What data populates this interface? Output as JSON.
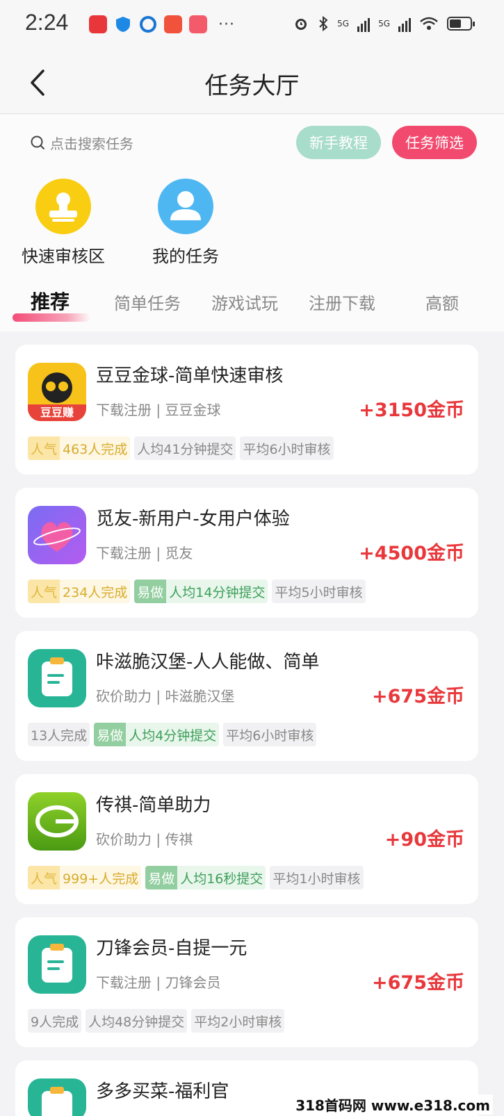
{
  "status_bar": {
    "time": "2:24",
    "more": "···",
    "net1": "5G",
    "net2": "5G"
  },
  "header": {
    "title": "任务大厅"
  },
  "search": {
    "placeholder": "点击搜索任务"
  },
  "buttons": {
    "tutorial": "新手教程",
    "filter": "任务筛选"
  },
  "quick_entries": [
    {
      "label": "快速审核区",
      "icon": "stamp-icon"
    },
    {
      "label": "我的任务",
      "icon": "user-icon"
    }
  ],
  "tabs": [
    {
      "label": "推荐",
      "active": true
    },
    {
      "label": "简单任务",
      "active": false
    },
    {
      "label": "游戏试玩",
      "active": false
    },
    {
      "label": "注册下载",
      "active": false
    },
    {
      "label": "高额",
      "active": false
    }
  ],
  "tasks": [
    {
      "title": "豆豆金球-简单快速审核",
      "subtitle": "下载注册 | 豆豆金球",
      "reward": "+3150金币",
      "icon": "doudou-app-icon",
      "icon_text": "豆豆赚",
      "tags": [
        {
          "head": "人气",
          "body": "463人完成",
          "kind": "pop"
        },
        {
          "head": "",
          "body": "人均41分钟提交",
          "kind": "grey"
        },
        {
          "head": "",
          "body": "平均6小时审核",
          "kind": "grey"
        }
      ]
    },
    {
      "title": "觅友-新用户-女用户体验",
      "subtitle": "下载注册 | 觅友",
      "reward": "+4500金币",
      "icon": "heart-app-icon",
      "tags": [
        {
          "head": "人气",
          "body": "234人完成",
          "kind": "pop"
        },
        {
          "head": "易做",
          "body": "人均14分钟提交",
          "kind": "easy"
        },
        {
          "head": "",
          "body": "平均5小时审核",
          "kind": "grey"
        }
      ]
    },
    {
      "title": "咔滋脆汉堡-人人能做、简单",
      "subtitle": "砍价助力 | 咔滋脆汉堡",
      "reward": "+675金币",
      "icon": "clipboard-app-icon",
      "tags": [
        {
          "head": "",
          "body": "13人完成",
          "kind": "grey"
        },
        {
          "head": "易做",
          "body": "人均4分钟提交",
          "kind": "easy"
        },
        {
          "head": "",
          "body": "平均6小时审核",
          "kind": "grey"
        }
      ]
    },
    {
      "title": "传祺-简单助力",
      "subtitle": "砍价助力 | 传祺",
      "reward": "+90金币",
      "icon": "trumpchi-app-icon",
      "tags": [
        {
          "head": "人气",
          "body": "999+人完成",
          "kind": "pop"
        },
        {
          "head": "易做",
          "body": "人均16秒提交",
          "kind": "easy"
        },
        {
          "head": "",
          "body": "平均1小时审核",
          "kind": "grey"
        }
      ]
    },
    {
      "title": "刀锋会员-自提一元",
      "subtitle": "下载注册 | 刀锋会员",
      "reward": "+675金币",
      "icon": "clipboard-app-icon",
      "tags": [
        {
          "head": "",
          "body": "9人完成",
          "kind": "grey"
        },
        {
          "head": "",
          "body": "人均48分钟提交",
          "kind": "grey"
        },
        {
          "head": "",
          "body": "平均2小时审核",
          "kind": "grey"
        }
      ]
    },
    {
      "title": "多多买菜-福利官",
      "subtitle": "",
      "reward": "",
      "icon": "clipboard-app-icon",
      "tags": []
    }
  ],
  "watermark": "318首码网 www.e318.com",
  "colors": {
    "accent": "#f24a6f",
    "reward": "#e8383c",
    "tutorial": "#a8dccb"
  }
}
